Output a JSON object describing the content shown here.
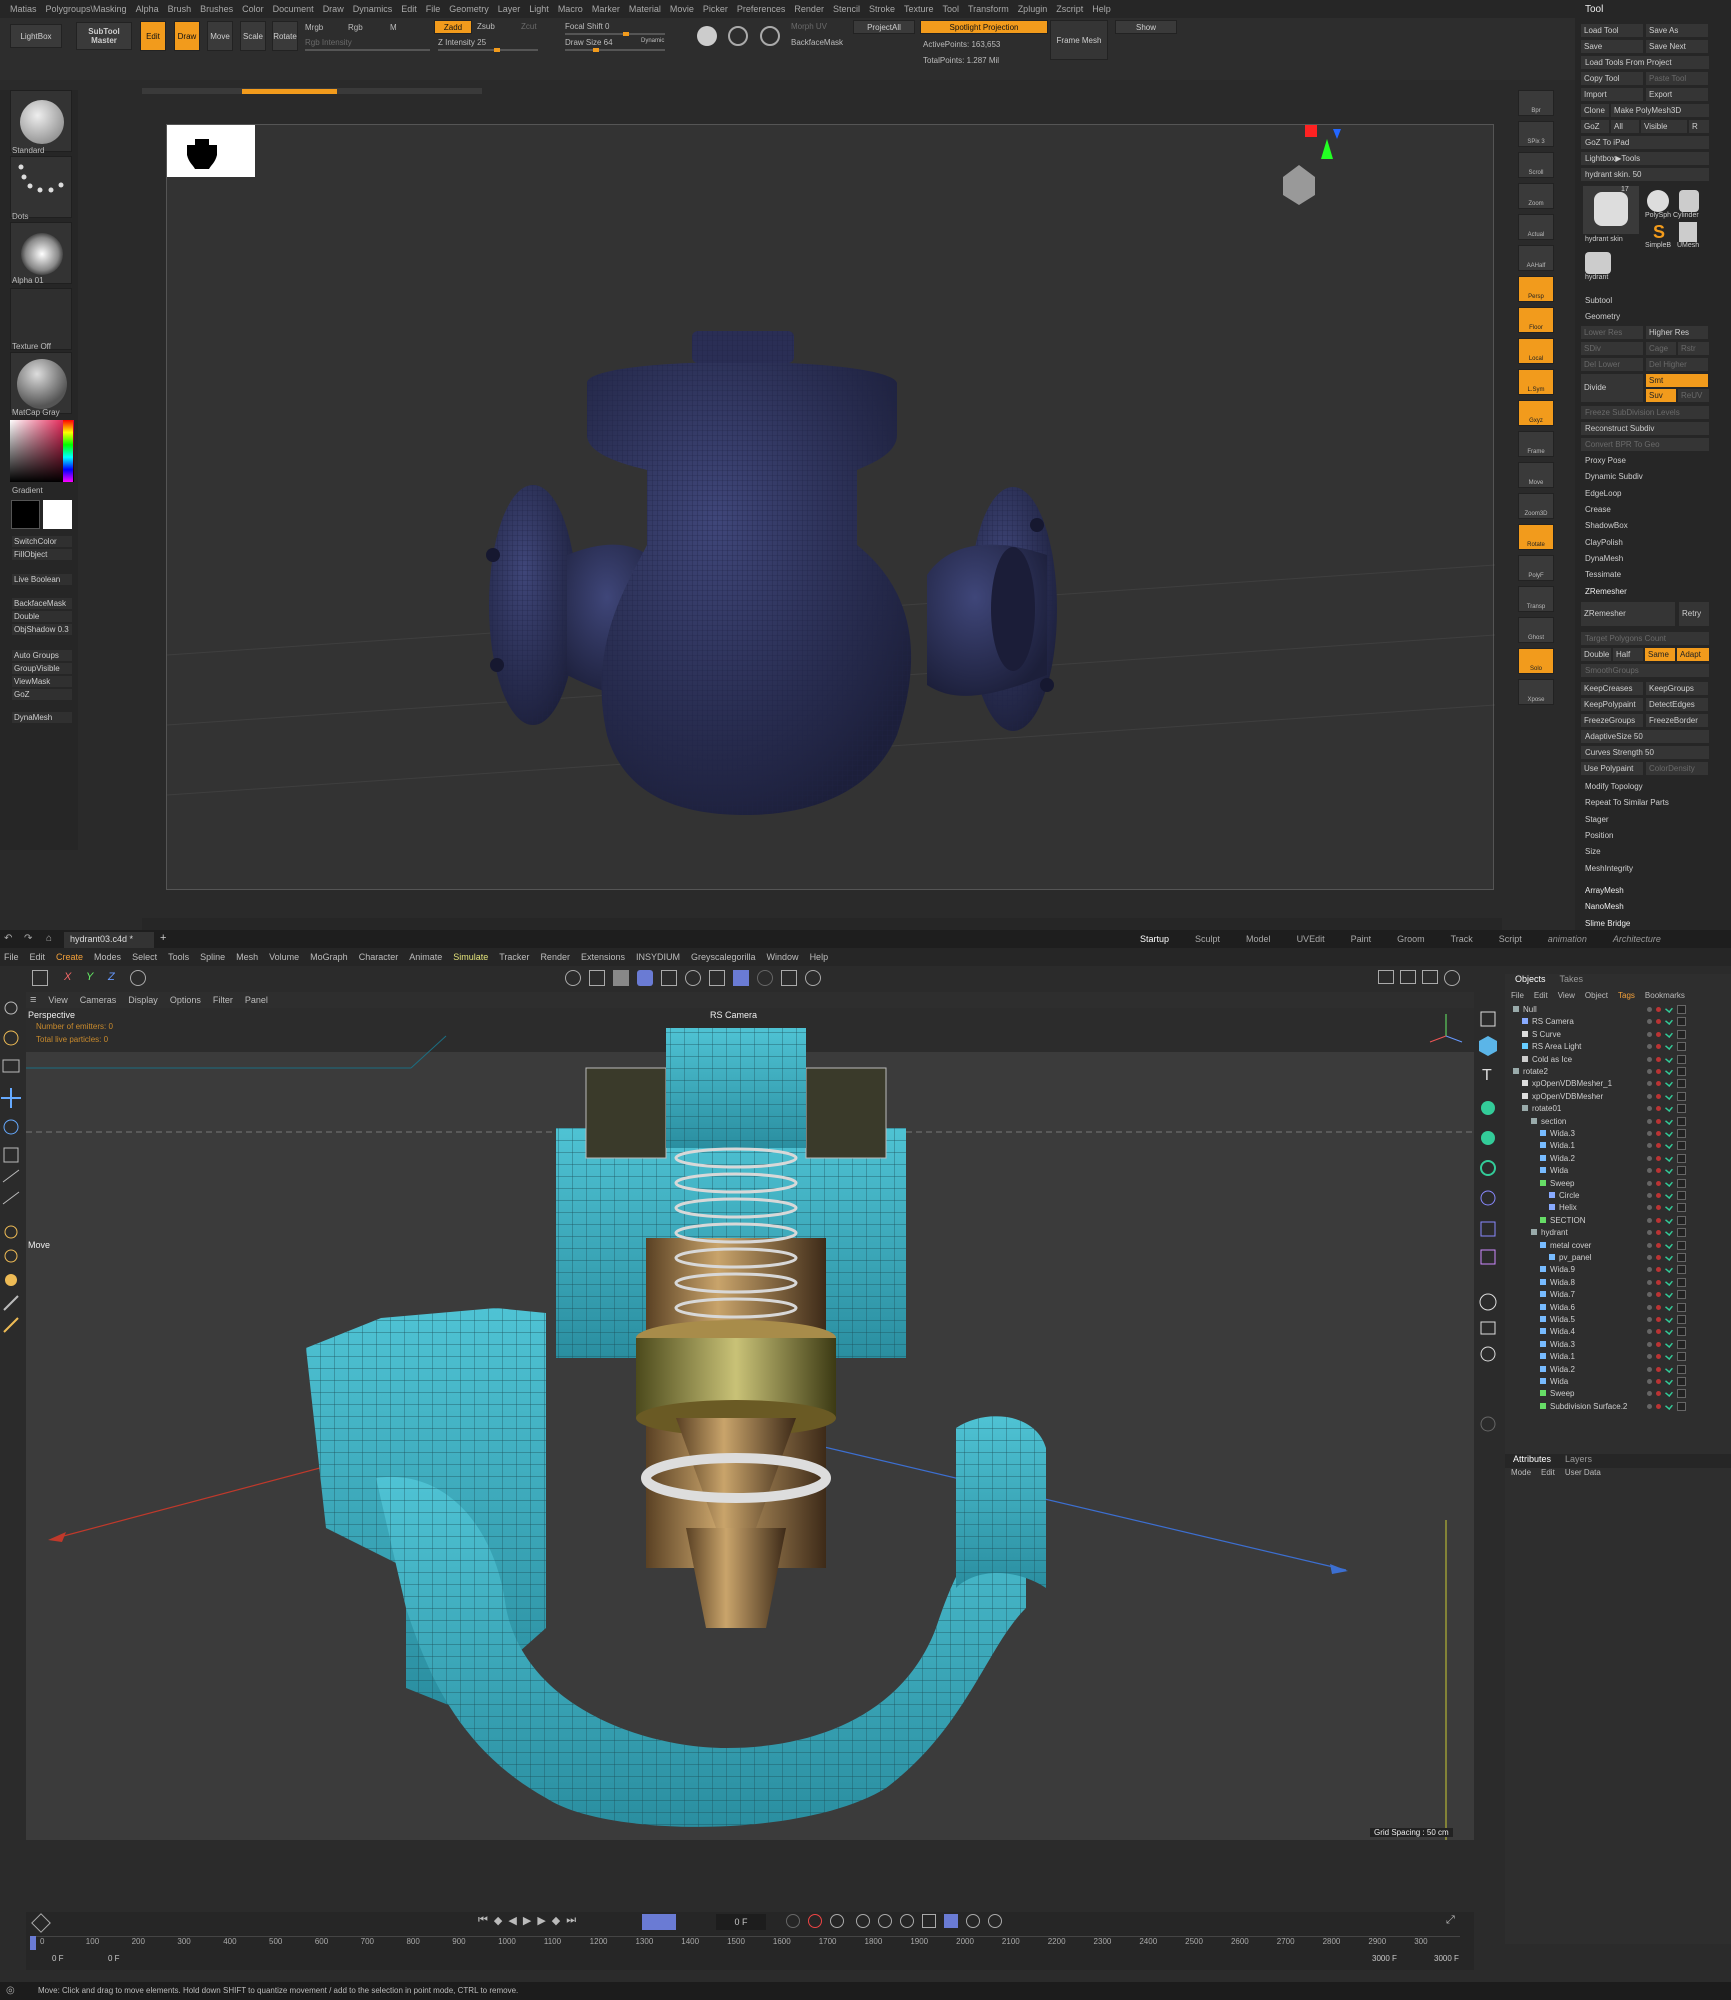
{
  "zbrush": {
    "menu": [
      "Matias",
      "Polygroups\\Masking",
      "Alpha",
      "Brush",
      "Brushes",
      "Color",
      "Document",
      "Draw",
      "Dynamics",
      "Edit",
      "File",
      "Geometry",
      "Layer",
      "Light",
      "Macro",
      "Marker",
      "Material",
      "Movie",
      "Picker",
      "Preferences",
      "Render",
      "Stencil",
      "Stroke",
      "Texture",
      "Tool",
      "Transform",
      "Zplugin",
      "Zscript",
      "Help"
    ],
    "top": {
      "lightbox": "LightBox",
      "subtool_master": "SubTool Master",
      "edit": "Edit",
      "draw": "Draw",
      "move": "Move",
      "scale": "Scale",
      "rotate": "Rotate",
      "mrgb": "Mrgb",
      "rgb": "Rgb",
      "m": "M",
      "rgb_intensity": "Rgb Intensity",
      "zadd": "Zadd",
      "zsub": "Zsub",
      "zcut": "Zcut",
      "z_intensity": "Z Intensity 25",
      "focal_shift": "Focal Shift 0",
      "draw_size": "Draw Size 64",
      "dynamic": "Dynamic",
      "morph_uv": "Morph UV",
      "backface_mask": "BackfaceMask",
      "project_all": "ProjectAll",
      "spotlight_projection": "Spotlight Projection",
      "active_points": "ActivePoints: 163,653",
      "total_points": "TotalPoints: 1.287 Mil",
      "frame_mesh": "Frame Mesh",
      "show": "Show"
    },
    "left": {
      "brush": "Standard",
      "stroke": "Dots",
      "alpha": "Alpha 01",
      "texture": "Texture Off",
      "material": "MatCap Gray",
      "gradient": "Gradient",
      "switch_color": "SwitchColor",
      "fill_object": "FillObject",
      "live_boolean": "Live Boolean",
      "backface_mask": "BackfaceMask",
      "double": "Double",
      "obj_shadow": "ObjShadow 0.3",
      "auto_groups": "Auto Groups",
      "group_visible": "GroupVisible",
      "view_mask": "ViewMask",
      "goz": "GoZ",
      "dynamesh": "DynaMesh"
    },
    "shelf": [
      "Bpr",
      "SPix 3",
      "Scroll",
      "Zoom",
      "Actual",
      "AAHalf",
      "Persp",
      "Floor",
      "Local",
      "L.Sym",
      "Gxyz",
      "Frame",
      "Move",
      "Zoom3D",
      "Rotate",
      "PolyF",
      "Transp",
      "Ghost",
      "Solo",
      "Xpose"
    ],
    "tool": {
      "title": "Tool",
      "load_tool": "Load Tool",
      "save_as": "Save As",
      "save": "Save",
      "save_next": "Save Next",
      "load_tools_from_project": "Load Tools From Project",
      "copy_tool": "Copy Tool",
      "paste_tool": "Paste Tool",
      "import": "Import",
      "export": "Export",
      "clone": "Clone",
      "make_polymesh": "Make PolyMesh3D",
      "goz": "GoZ",
      "all": "All",
      "visible": "Visible",
      "r": "R",
      "goz_ipad": "GoZ To iPad",
      "lightbox_tools": "Lightbox▶Tools",
      "current": "hydrant skin. 50",
      "count": "17",
      "thumb1": "hydrant skin",
      "thumb2": "PolySph",
      "thumb3": "Cylinder",
      "thumb4": "SimpleB",
      "thumb5": "UMesh",
      "thumb6": "hydrant",
      "subtool": "Subtool",
      "geometry": "Geometry",
      "lower_res": "Lower Res",
      "higher_res": "Higher Res",
      "sdiv": "SDiv",
      "cage": "Cage",
      "rstr": "Rstr",
      "del_lower": "Del Lower",
      "del_higher": "Del Higher",
      "divide": "Divide",
      "smt": "Smt",
      "suv": "Suv",
      "reuv": "ReUV",
      "freeze_subdiv": "Freeze SubDivision Levels",
      "reconstruct_subdiv": "Reconstruct Subdiv",
      "convert_bpr": "Convert BPR To Geo",
      "items": [
        "Proxy Pose",
        "Dynamic Subdiv",
        "EdgeLoop",
        "Crease",
        "ShadowBox",
        "ClayPolish",
        "DynaMesh",
        "Tessimate"
      ],
      "zremesher_header": "ZRemesher",
      "zremesher": "ZRemesher",
      "retry": "Retry",
      "target_poly": "Target Polygons Count",
      "double": "Double",
      "half": "Half",
      "same": "Same",
      "adapt": "Adapt",
      "smooth_groups": "SmoothGroups",
      "keep_creases": "KeepCreases",
      "keep_groups": "KeepGroups",
      "keep_polypaint": "KeepPolypaint",
      "detect_edges": "DetectEdges",
      "freeze_groups": "FreezeGroups",
      "freeze_border": "FreezeBorder",
      "adaptive_size": "AdaptiveSize 50",
      "curves_strength": "Curves Strength 50",
      "use_polypaint": "Use Polypaint",
      "color_density": "ColorDensity",
      "items2": [
        "Modify Topology",
        "Repeat To Similar Parts",
        "Stager",
        "Position",
        "Size",
        "MeshIntegrity"
      ],
      "items3": [
        "ArrayMesh",
        "NanoMesh",
        "Slime Bridge"
      ]
    }
  },
  "c4d": {
    "file_tab": "hydrant03.c4d *",
    "layouts": [
      "Startup",
      "Sculpt",
      "Model",
      "UVEdit",
      "Paint",
      "Groom",
      "Track",
      "Script",
      "animation",
      "Architecture"
    ],
    "menu": [
      "File",
      "Edit",
      "Create",
      "Modes",
      "Select",
      "Tools",
      "Spline",
      "Mesh",
      "Volume",
      "MoGraph",
      "Character",
      "Animate",
      "Simulate",
      "Tracker",
      "Render",
      "Extensions",
      "INSYDIUM",
      "Greyscalegorilla",
      "Window",
      "Help"
    ],
    "axes": [
      "X",
      "Y",
      "Z"
    ],
    "vp_menu": [
      "View",
      "Cameras",
      "Display",
      "Options",
      "Filter",
      "Panel"
    ],
    "vp": {
      "name": "Perspective",
      "camera": "RS Camera",
      "emitters": "Number of emitters: 0",
      "particles": "Total live particles: 0",
      "move": "Move",
      "grid": "Grid Spacing : 50 cm"
    },
    "objects_tabs": [
      "Objects",
      "Takes"
    ],
    "objects_menu": [
      "File",
      "Edit",
      "View",
      "Object",
      "Tags",
      "Bookmarks"
    ],
    "objects": [
      {
        "name": "Null",
        "lvl": 0,
        "c": "#9aa"
      },
      {
        "name": "RS Camera",
        "lvl": 1,
        "c": "#8af"
      },
      {
        "name": "S Curve",
        "lvl": 1,
        "c": "#ddd"
      },
      {
        "name": "RS Area Light",
        "lvl": 1,
        "c": "#6cf"
      },
      {
        "name": "Cold as Ice",
        "lvl": 1,
        "c": "#ccc"
      },
      {
        "name": "rotate2",
        "lvl": 0,
        "c": "#9aa"
      },
      {
        "name": "xpOpenVDBMesher_1",
        "lvl": 1,
        "c": "#ddd"
      },
      {
        "name": "xpOpenVDBMesher",
        "lvl": 1,
        "c": "#ddd"
      },
      {
        "name": "rotate01",
        "lvl": 1,
        "c": "#9aa"
      },
      {
        "name": "section",
        "lvl": 2,
        "c": "#9aa"
      },
      {
        "name": "Wida.3",
        "lvl": 3,
        "c": "#7bf"
      },
      {
        "name": "Wida.1",
        "lvl": 3,
        "c": "#7bf"
      },
      {
        "name": "Wida.2",
        "lvl": 3,
        "c": "#7bf"
      },
      {
        "name": "Wida",
        "lvl": 3,
        "c": "#7bf"
      },
      {
        "name": "Sweep",
        "lvl": 3,
        "c": "#6d6"
      },
      {
        "name": "Circle",
        "lvl": 4,
        "c": "#8af"
      },
      {
        "name": "Helix",
        "lvl": 4,
        "c": "#8af"
      },
      {
        "name": "SECTION",
        "lvl": 3,
        "c": "#6d6"
      },
      {
        "name": "hydrant",
        "lvl": 2,
        "c": "#9aa"
      },
      {
        "name": "metal cover",
        "lvl": 3,
        "c": "#7bf"
      },
      {
        "name": "pv_panel",
        "lvl": 4,
        "c": "#7bf"
      },
      {
        "name": "Wida.9",
        "lvl": 3,
        "c": "#7bf"
      },
      {
        "name": "Wida.8",
        "lvl": 3,
        "c": "#7bf"
      },
      {
        "name": "Wida.7",
        "lvl": 3,
        "c": "#7bf"
      },
      {
        "name": "Wida.6",
        "lvl": 3,
        "c": "#7bf"
      },
      {
        "name": "Wida.5",
        "lvl": 3,
        "c": "#7bf"
      },
      {
        "name": "Wida.4",
        "lvl": 3,
        "c": "#7bf"
      },
      {
        "name": "Wida.3",
        "lvl": 3,
        "c": "#7bf"
      },
      {
        "name": "Wida.1",
        "lvl": 3,
        "c": "#7bf"
      },
      {
        "name": "Wida.2",
        "lvl": 3,
        "c": "#7bf"
      },
      {
        "name": "Wida",
        "lvl": 3,
        "c": "#7bf"
      },
      {
        "name": "Sweep",
        "lvl": 3,
        "c": "#6d6"
      },
      {
        "name": "Subdivision Surface.2",
        "lvl": 3,
        "c": "#6d6"
      }
    ],
    "attr_tabs": [
      "Attributes",
      "Layers"
    ],
    "attr_menu": [
      "Mode",
      "Edit",
      "User Data"
    ],
    "timeline": {
      "frame": "0 F",
      "start": "0 F",
      "start2": "0 F",
      "end": "3000 F",
      "end2": "3000 F",
      "ticks": [
        "0",
        "100",
        "200",
        "300",
        "400",
        "500",
        "600",
        "700",
        "800",
        "900",
        "1000",
        "1100",
        "1200",
        "1300",
        "1400",
        "1500",
        "1600",
        "1700",
        "1800",
        "1900",
        "2000",
        "2100",
        "2200",
        "2300",
        "2400",
        "2500",
        "2600",
        "2700",
        "2800",
        "2900",
        "300"
      ]
    },
    "status": "Move: Click and drag to move elements. Hold down SHIFT to quantize movement / add to the selection in point mode, CTRL to remove."
  }
}
